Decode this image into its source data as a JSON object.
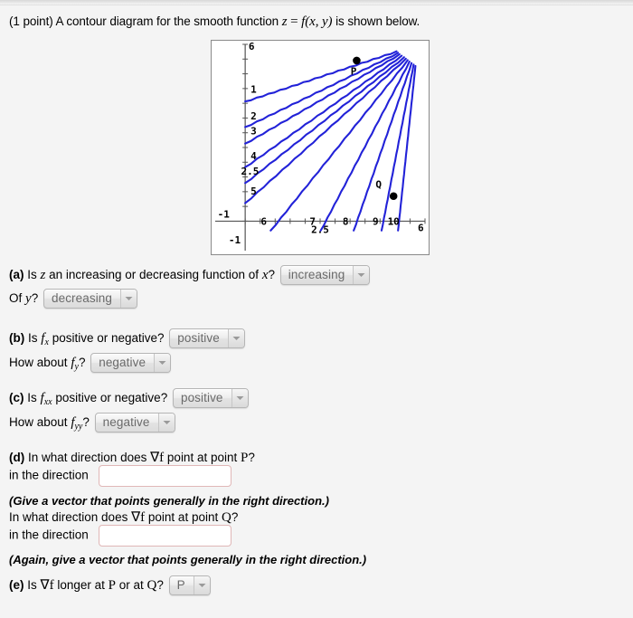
{
  "prompt": {
    "points": "(1 point)",
    "text_before": "A contour diagram for the smooth function",
    "formula_z": "z",
    "formula_eq": "=",
    "formula_f": "f",
    "formula_args": "(x, y)",
    "text_after": "is shown below."
  },
  "chart_data": {
    "type": "line",
    "title": "",
    "xlabel": "",
    "ylabel": "",
    "xlim": [
      -1,
      6
    ],
    "ylim": [
      -1,
      6
    ],
    "grid": false,
    "axis_tick_labels": {
      "x": [
        "-1",
        "2.5",
        "6"
      ],
      "y": [
        "-1",
        "6"
      ]
    },
    "x_axis_ticks": [
      0,
      0.5,
      1,
      1.5,
      2,
      2.5,
      3,
      3.5,
      4,
      4.5,
      5,
      5.5,
      6
    ],
    "y_axis_ticks": [
      0,
      0.5,
      1,
      1.5,
      2,
      2.5,
      3,
      3.5,
      4,
      4.5,
      5,
      5.5,
      6
    ],
    "contour_color": "#2222d8",
    "contour_labels": [
      "1",
      "2",
      "3",
      "4",
      "2.5",
      "5",
      "6",
      "7",
      "8",
      "9",
      "10"
    ],
    "contours": [
      {
        "label": "1",
        "label_x": 0.28,
        "label_y": 4.35,
        "x0": 0.0,
        "y0": 4.05,
        "x1": 5.05,
        "y1": 5.75
      },
      {
        "label": "2",
        "label_x": 0.28,
        "label_y": 3.45,
        "x0": 0.0,
        "y0": 3.18,
        "x1": 5.1,
        "y1": 5.7
      },
      {
        "label": "3",
        "label_x": 0.28,
        "label_y": 2.95,
        "x0": 0.0,
        "y0": 2.62,
        "x1": 5.15,
        "y1": 5.65
      },
      {
        "label": "4",
        "label_x": 0.28,
        "label_y": 2.1,
        "x0": 0.0,
        "y0": 1.82,
        "x1": 5.22,
        "y1": 5.6
      },
      {
        "label": "2.5",
        "label_x": 0.16,
        "label_y": 1.58,
        "x0": 0.0,
        "y0": 1.28,
        "x1": 5.3,
        "y1": 5.55
      },
      {
        "label": "5",
        "label_x": 0.28,
        "label_y": 0.9,
        "x0": 0.0,
        "y0": 0.6,
        "x1": 5.36,
        "y1": 5.5
      },
      {
        "label": "6",
        "label_x": 0.62,
        "label_y": -0.12,
        "x0": 0.85,
        "y0": -0.33,
        "x1": 5.42,
        "y1": 5.45
      },
      {
        "label": "7",
        "label_x": 2.25,
        "label_y": -0.12,
        "x0": 2.52,
        "y0": -0.33,
        "x1": 5.48,
        "y1": 5.4
      },
      {
        "label": "8",
        "label_x": 3.35,
        "label_y": -0.12,
        "x0": 3.62,
        "y0": -0.33,
        "x1": 5.55,
        "y1": 5.35
      },
      {
        "label": "9",
        "label_x": 4.35,
        "label_y": -0.12,
        "x0": 4.55,
        "y0": -0.33,
        "x1": 5.62,
        "y1": 5.3
      },
      {
        "label": "10",
        "label_x": 4.95,
        "label_y": -0.12,
        "x0": 5.1,
        "y0": -0.33,
        "x1": 5.68,
        "y1": 5.25
      }
    ],
    "points": [
      {
        "name": "P",
        "x": 3.72,
        "y": 5.45,
        "label": "P",
        "label_dx": -0.1,
        "label_dy": -0.48
      },
      {
        "name": "Q",
        "x": 4.95,
        "y": 0.85,
        "label": "Q",
        "label_dx": -0.5,
        "label_dy": 0.28
      }
    ]
  },
  "questions": {
    "a": {
      "label": "(a)",
      "text1_pre": "Is",
      "text1_var": "z",
      "text1_post": "an increasing or decreasing function of",
      "text1_var2": "x",
      "text1_q": "?",
      "select1_value": "increasing",
      "text2_pre": "Of",
      "text2_var": "y",
      "text2_q": "?",
      "select2_value": "decreasing"
    },
    "b": {
      "label": "(b)",
      "text1_pre": "Is",
      "fx_base": "f",
      "fx_sub": "x",
      "text1_post": "positive or negative?",
      "select1_value": "positive",
      "text2_pre": "How about",
      "fy_base": "f",
      "fy_sub": "y",
      "text2_q": "?",
      "select2_value": "negative"
    },
    "c": {
      "label": "(c)",
      "text1_pre": "Is",
      "fxx_base": "f",
      "fxx_sub": "xx",
      "text1_post": "positive or negative?",
      "select1_value": "positive",
      "text2_pre": "How about",
      "fyy_base": "f",
      "fyy_sub": "yy",
      "text2_q": "?",
      "select2_value": "negative"
    },
    "d": {
      "label": "(d)",
      "text1_pre": "In what direction does",
      "grad": "∇f",
      "text1_mid": "point at point",
      "point1": "P",
      "text1_q": "?",
      "direction_label_1": "in the direction",
      "input1_value": "",
      "note1": "(Give a vector that points generally in the right direction.)",
      "text2_pre": "In what direction does",
      "text2_mid": "point at point",
      "point2": "Q",
      "text2_q": "?",
      "direction_label_2": "in the direction",
      "input2_value": "",
      "note2": "(Again, give a vector that points generally in the right direction.)"
    },
    "e": {
      "label": "(e)",
      "text_pre": "Is",
      "grad": "∇f",
      "text_mid": "longer at",
      "point1": "P",
      "text_or": "or at",
      "point2": "Q",
      "text_q": "?",
      "select_value": "P"
    }
  }
}
